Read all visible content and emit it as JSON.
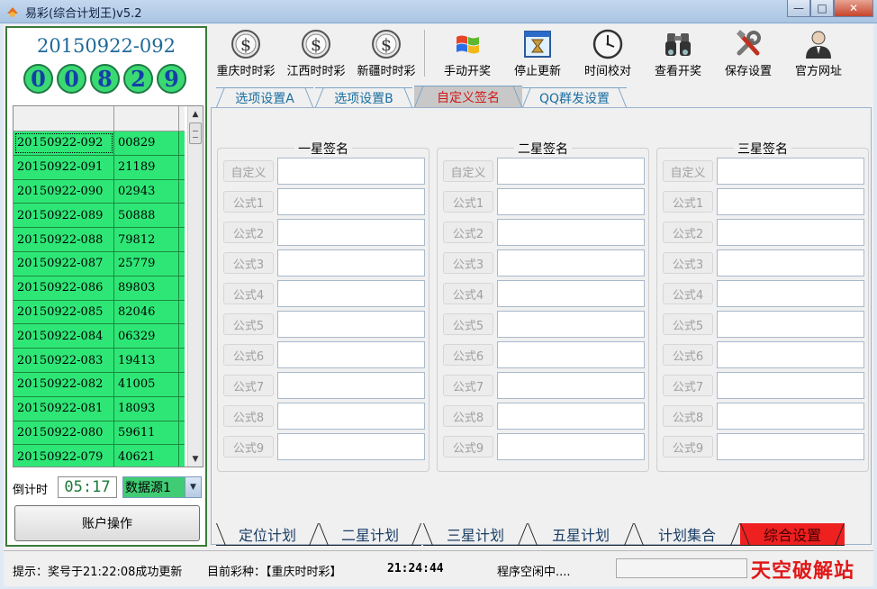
{
  "window": {
    "title": "易彩(综合计划王)v5.2",
    "min_label": "—",
    "max_label": "□",
    "close_label": "✕"
  },
  "left_panel": {
    "current_period": "20150922-092",
    "balls": [
      "0",
      "0",
      "8",
      "2",
      "9"
    ],
    "draws": [
      {
        "period": "20150922-092",
        "number": "00829"
      },
      {
        "period": "20150922-091",
        "number": "21189"
      },
      {
        "period": "20150922-090",
        "number": "02943"
      },
      {
        "period": "20150922-089",
        "number": "50888"
      },
      {
        "period": "20150922-088",
        "number": "79812"
      },
      {
        "period": "20150922-087",
        "number": "25779"
      },
      {
        "period": "20150922-086",
        "number": "89803"
      },
      {
        "period": "20150922-085",
        "number": "82046"
      },
      {
        "period": "20150922-084",
        "number": "06329"
      },
      {
        "period": "20150922-083",
        "number": "19413"
      },
      {
        "period": "20150922-082",
        "number": "41005"
      },
      {
        "period": "20150922-081",
        "number": "18093"
      },
      {
        "period": "20150922-080",
        "number": "59611"
      },
      {
        "period": "20150922-079",
        "number": "40621"
      }
    ],
    "countdown_label": "倒计时",
    "countdown": "05:17",
    "data_source": "数据源1",
    "account_button": "账户操作"
  },
  "toolbar": {
    "buttons": [
      {
        "label": "重庆时时彩",
        "icon": "dollar-coin-icon"
      },
      {
        "label": "江西时时彩",
        "icon": "dollar-coin-icon"
      },
      {
        "label": "新疆时时彩",
        "icon": "dollar-coin-icon"
      },
      {
        "label": "手动开奖",
        "icon": "windows-logo-icon"
      },
      {
        "label": "停止更新",
        "icon": "hourglass-window-icon"
      },
      {
        "label": "时间校对",
        "icon": "clock-icon"
      },
      {
        "label": "查看开奖",
        "icon": "binoculars-icon"
      },
      {
        "label": "保存设置",
        "icon": "tools-icon"
      },
      {
        "label": "官方网址",
        "icon": "person-icon"
      }
    ]
  },
  "top_tabs": [
    "选项设置A",
    "选项设置B",
    "自定义签名",
    "QQ群发设置"
  ],
  "active_top_tab": 2,
  "signature_groups": [
    {
      "title": "一星签名"
    },
    {
      "title": "二星签名"
    },
    {
      "title": "三星签名"
    }
  ],
  "signature_row_labels": [
    "自定义",
    "公式1",
    "公式2",
    "公式3",
    "公式4",
    "公式5",
    "公式6",
    "公式7",
    "公式8",
    "公式9"
  ],
  "bottom_tabs": [
    "定位计划",
    "二星计划",
    "三星计划",
    "五星计划",
    "计划集合",
    "综合设置"
  ],
  "active_bottom_tab": 5,
  "status": {
    "hint": "提示：奖号于21:22:08成功更新",
    "current_type": "目前彩种：【重庆时时彩】",
    "time": "21:24:44",
    "state": "程序空闲中....",
    "watermark": "天空破解站"
  },
  "colors": {
    "grid_row": "#2ee676",
    "ball": "#3bd972",
    "active_tab": "#c8c8c8",
    "active_bottom_tab": "#ee2020",
    "watermark": "#e01818"
  }
}
